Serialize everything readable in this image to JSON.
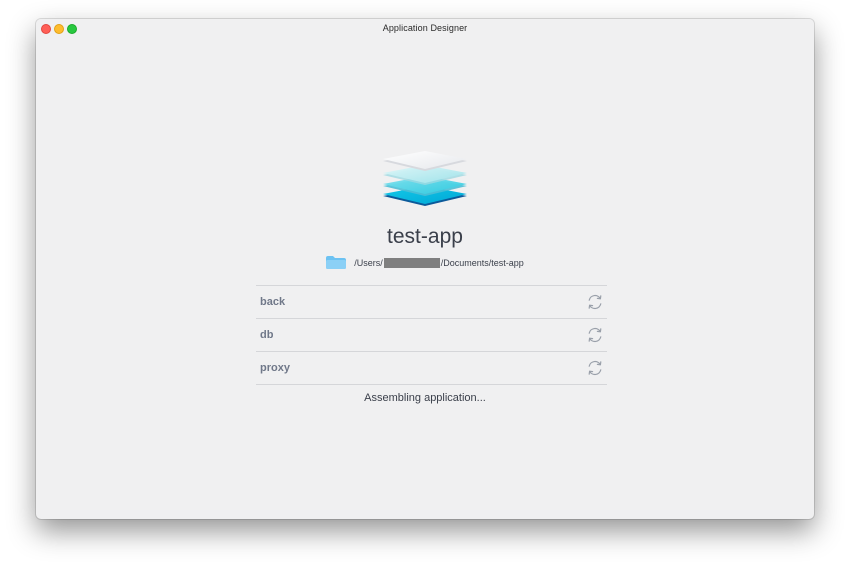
{
  "window": {
    "title": "Application Designer"
  },
  "app": {
    "name": "test-app",
    "icon": "layered-stack-icon",
    "path_prefix": "/Users/",
    "path_suffix": "/Documents/test-app",
    "path_redacted": true
  },
  "services": [
    {
      "name": "back",
      "status_icon": "refresh-icon"
    },
    {
      "name": "db",
      "status_icon": "refresh-icon"
    },
    {
      "name": "proxy",
      "status_icon": "refresh-icon"
    }
  ],
  "status": {
    "message": "Assembling application..."
  },
  "colors": {
    "window_bg": "#f0f0f1",
    "text_primary": "#3a3f4a",
    "text_service": "#707889",
    "divider": "#d5d6d9",
    "folder": "#6cc2f2",
    "layer_top": "#f7f7f8",
    "layer_mid": "#b8ecf0",
    "layer_bottom": "#00c7e6"
  }
}
